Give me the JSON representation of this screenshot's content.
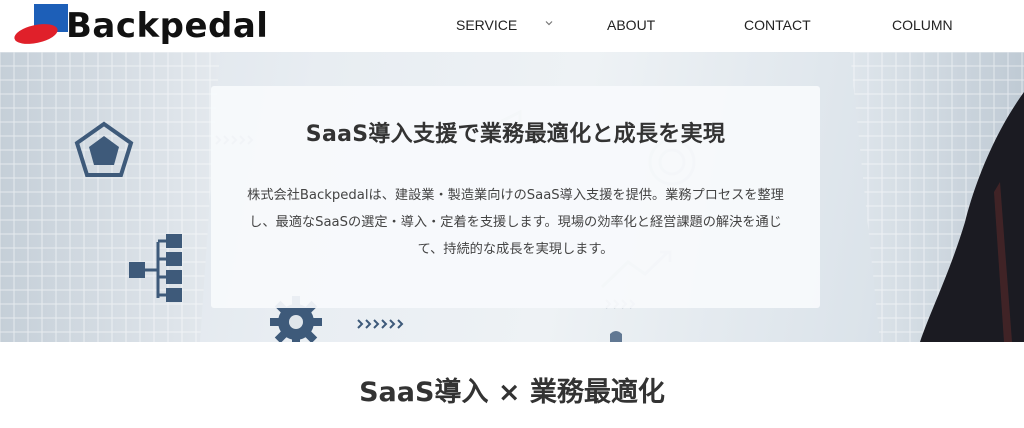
{
  "header": {
    "logo_text": "Backpedal",
    "nav": [
      {
        "label": "SERVICE",
        "has_dropdown": true
      },
      {
        "label": "ABOUT"
      },
      {
        "label": "CONTACT"
      },
      {
        "label": "COLUMN"
      }
    ]
  },
  "hero": {
    "title": "SaaS導入支援で業務最適化と成長を実現",
    "description": "株式会社Backpedalは、建設業・製造業向けのSaaS導入支援を提供。業務プロセスを整理し、最適なSaaSの選定・導入・定着を支援します。現場の効率化と経営課題の解決を通じて、持続的な成長を実現します。"
  },
  "section": {
    "title": "SaaS導入 × 業務最適化"
  },
  "colors": {
    "logo_red": "#e0202a",
    "logo_blue": "#1d5fb8",
    "icon_navy": "#3e5a7a"
  }
}
